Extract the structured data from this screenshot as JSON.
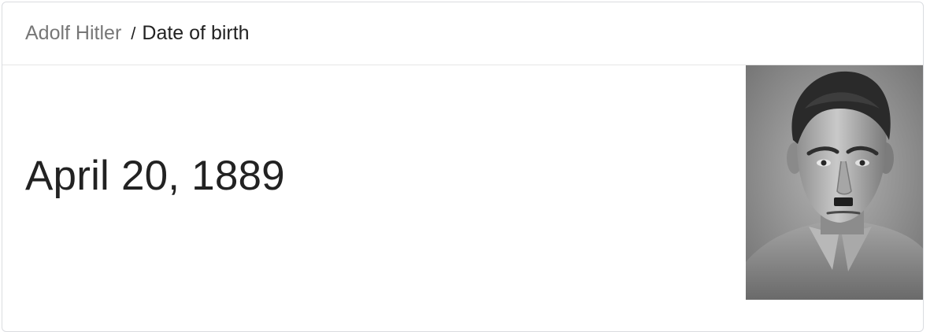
{
  "breadcrumb": {
    "entity": "Adolf Hitler",
    "separator": "/",
    "attribute": "Date of birth"
  },
  "answer": {
    "value": "April 20, 1889"
  },
  "image": {
    "subject": "portrait photograph",
    "style": "black and white"
  }
}
